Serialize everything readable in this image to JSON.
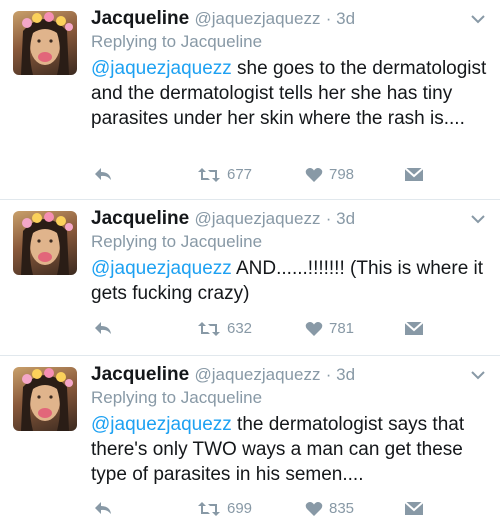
{
  "colors": {
    "mention": "#1da1f2",
    "meta": "#8899a6",
    "text": "#14171a",
    "divider": "#e1e8ed"
  },
  "tweets": [
    {
      "name": "Jacqueline",
      "handle": "@jaquezjaquezz",
      "time": "· 3d",
      "replying": "Replying to Jacqueline",
      "mention": "@jaquezjaquezz",
      "text": " she goes to the dermatologist and the dermatologist tells her she has tiny parasites under her skin where the rash is....",
      "retweets": "677",
      "likes": "798"
    },
    {
      "name": "Jacqueline",
      "handle": "@jaquezjaquezz",
      "time": "· 3d",
      "replying": "Replying to Jacqueline",
      "mention": "@jaquezjaquezz",
      "text": " AND......!!!!!!! (This is where it gets fucking crazy)",
      "retweets": "632",
      "likes": "781"
    },
    {
      "name": "Jacqueline",
      "handle": "@jaquezjaquezz",
      "time": "· 3d",
      "replying": "Replying to Jacqueline",
      "mention": "@jaquezjaquezz",
      "text": " the dermatologist says that there's only TWO ways a man can get these type of parasites in his semen....",
      "retweets": "699",
      "likes": "835"
    }
  ],
  "icons": [
    "reply-icon",
    "retweet-icon",
    "like-icon",
    "direct-message-icon",
    "chevron-down-icon"
  ]
}
